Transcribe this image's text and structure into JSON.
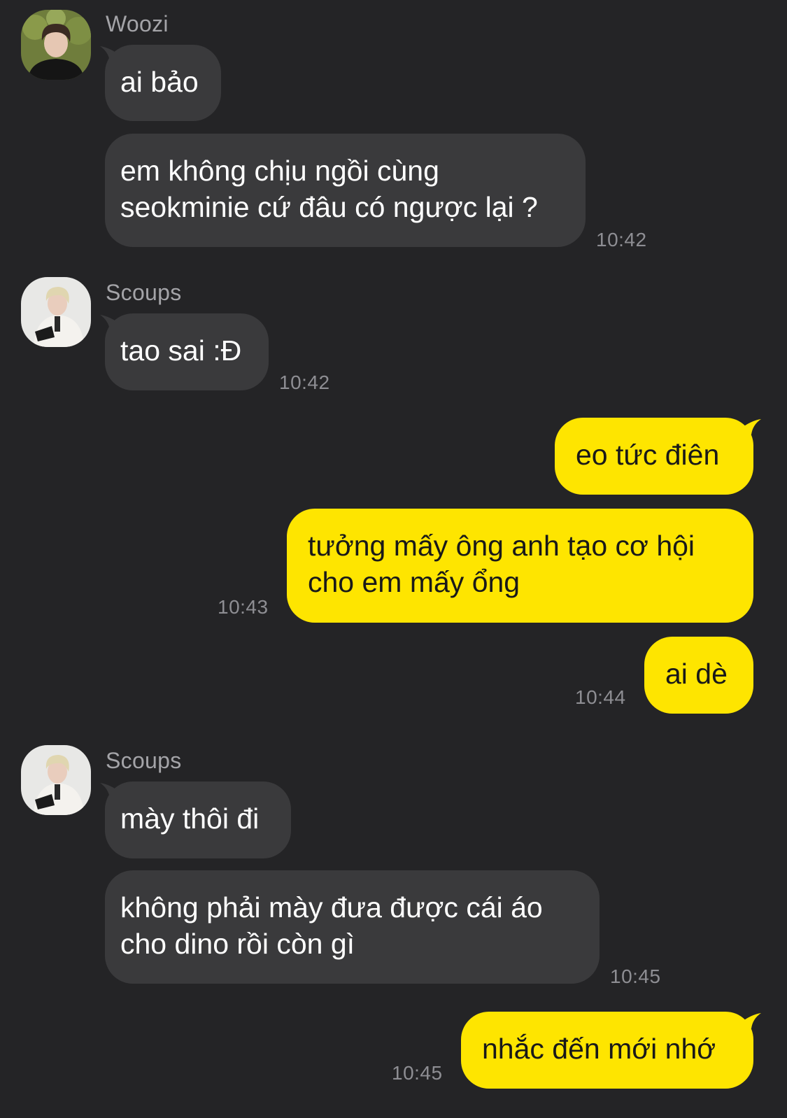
{
  "conversation": {
    "colors": {
      "background": "#242426",
      "incoming_bubble": "#3a3a3c",
      "outgoing_bubble": "#fee500",
      "incoming_text": "#ffffff",
      "outgoing_text": "#191919",
      "sender_name": "#a4a4a8",
      "timestamp": "#8e8e93"
    },
    "groups": [
      {
        "sender": "Woozi",
        "avatar_icon": "profile-photo-icon",
        "messages": [
          {
            "text": "ai bảo"
          },
          {
            "text": "em không chịu ngồi cùng\nseokminie cứ đâu có ngược lại ?",
            "time": "10:42"
          }
        ]
      },
      {
        "sender": "Scoups",
        "avatar_icon": "profile-photo-icon",
        "messages": [
          {
            "text": "tao sai :Đ",
            "time": "10:42"
          }
        ]
      },
      {
        "sender": "me",
        "messages": [
          {
            "text": "eo tức điên"
          },
          {
            "text": "tưởng mấy ông anh tạo cơ hội\ncho em mấy ổng",
            "time": "10:43"
          },
          {
            "text": "ai dè",
            "time": "10:44"
          }
        ]
      },
      {
        "sender": "Scoups",
        "avatar_icon": "profile-photo-icon",
        "messages": [
          {
            "text": "mày thôi đi"
          },
          {
            "text": "không phải mày đưa được cái áo\ncho dino rồi còn gì",
            "time": "10:45"
          }
        ]
      },
      {
        "sender": "me",
        "messages": [
          {
            "text": "nhắc đến mới nhớ",
            "time": "10:45"
          }
        ]
      }
    ]
  }
}
